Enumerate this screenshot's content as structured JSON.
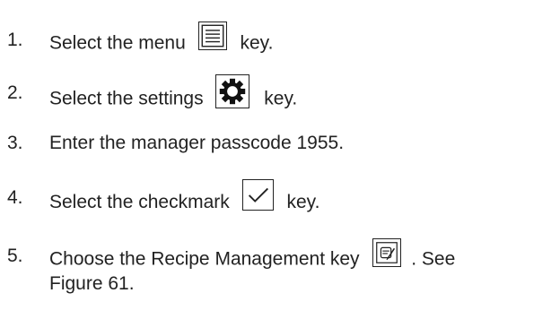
{
  "steps": [
    {
      "number": "1.",
      "before": "Select the menu",
      "icon": "menu-icon",
      "after": "key."
    },
    {
      "number": "2.",
      "before": "Select the settings",
      "icon": "settings-gear-icon",
      "after": "key."
    },
    {
      "number": "3.",
      "text": "Enter the manager passcode 1955."
    },
    {
      "number": "4.",
      "before": "Select the checkmark",
      "icon": "checkmark-icon",
      "after": "key."
    },
    {
      "number": "5.",
      "before": "Choose the Recipe Management key",
      "icon": "recipe-management-icon",
      "after": ". See",
      "continuation": "Figure 61."
    }
  ]
}
